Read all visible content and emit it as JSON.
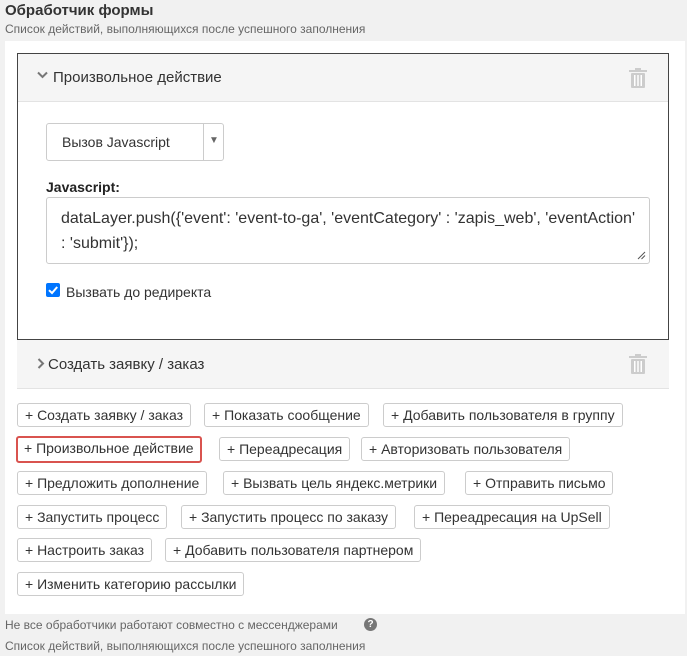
{
  "header": {
    "title": "Обработчик формы",
    "subtitle": "Список действий, выполняющихся после успешного заполнения"
  },
  "card1": {
    "title": "Произвольное действие",
    "select_value": "Вызов Javascript",
    "js_label": "Javascript:",
    "js_code": "dataLayer.push({'event': 'event-to-ga', 'eventCategory' : 'zapis_web', 'eventAction' : 'submit'});",
    "redirect_label": "Вызвать до редиректа",
    "redirect_checked": true
  },
  "card2": {
    "title": "Создать заявку / заказ"
  },
  "actions": {
    "create_order": "+ Создать заявку / заказ",
    "show_message": "+ Показать сообщение",
    "add_user_group": "+ Добавить пользователя в группу",
    "custom_action": "+ Произвольное действие",
    "redirect": "+ Переадресация",
    "authorize_user": "+ Авторизовать пользователя",
    "offer_addon": "+ Предложить дополнение",
    "yandex_goal": "+ Вызвать цель яндекс.метрики",
    "send_letter": "+ Отправить письмо",
    "start_process": "+ Запустить процесс",
    "start_process_order": "+ Запустить процесс по заказу",
    "redirect_upsell": "+ Переадресация на UpSell",
    "configure_order": "+ Настроить заказ",
    "add_partner": "+ Добавить пользователя партнером",
    "change_category": "+ Изменить категорию рассылки"
  },
  "footer": {
    "note": "Не все обработчики работают совместно с мессенджерами",
    "help_glyph": "?",
    "subtitle": "Список действий, выполняющихся после успешного заполнения"
  },
  "colors": {
    "highlight_border": "#d9534f",
    "checkbox_accent": "#0075ff"
  },
  "icons": {
    "chevron_expanded": "chevron-down-icon",
    "chevron_collapsed": "chevron-right-icon",
    "delete": "trash-icon",
    "help": "help-circle-icon"
  }
}
